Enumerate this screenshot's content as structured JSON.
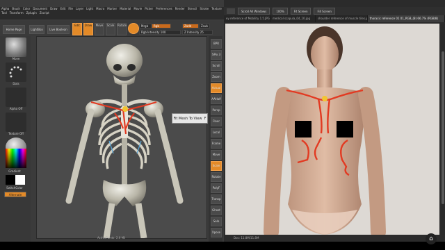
{
  "zbrush": {
    "menu": [
      "Alpha",
      "Brush",
      "Color",
      "Document",
      "Draw",
      "Edit",
      "File",
      "Layer",
      "Light",
      "Macro",
      "Marker",
      "Material",
      "Movie",
      "Picker",
      "Preferences",
      "Render",
      "Stencil",
      "Stroke",
      "Texture",
      "Tool",
      "Transform",
      "Zplugin",
      "Zscript"
    ],
    "toolbar": {
      "home_page": "Home Page",
      "lightbox": "LightBox",
      "live_boolean": "Live Boolean",
      "edit": "Edit",
      "draw": "Draw",
      "move": "Move",
      "scale": "Scale",
      "rotate": "Rotate",
      "mrgb": "Mrgb",
      "rgb": "Rgb",
      "rgb_intensity": "Rgb Intensity 100",
      "zadd": "Zadd",
      "zsub": "Zsub",
      "z_intensity": "Z Intensity 25"
    },
    "shelf": {
      "brush_label": "Move",
      "stroke_label": "Dots",
      "alpha_label": "Alpha Off",
      "texture_label": "Texture Off",
      "material_label": "Basic",
      "gradient_label": "Gradient",
      "switch_color_label": "SwitchColor",
      "alternate_label": "Alternate"
    },
    "tooltip": "Fit Mesh To View",
    "tooltip_key": "F",
    "status": "ActivePoints: 2.6 Mil",
    "right_shelf": [
      "BPR",
      "SPix 3",
      "Scroll",
      "Zoom",
      "Actual",
      "AAHalf",
      "Persp",
      "Floor",
      "Local",
      "Frame",
      "Move",
      "Scale",
      "Rotate",
      "PolyF",
      "Transp",
      "Ghost",
      "Solo",
      "Xpose"
    ]
  },
  "photoshop": {
    "options": [
      "Scroll All Windows",
      "100%",
      "Fit Screen",
      "Fill Screen"
    ],
    "tabs": [
      "ey reference of Mobility 1.5.JPG",
      "medical scapula_04_10.jpg",
      "shoulder reference of muscle tiles.jpg",
      "thoracic reference 01 01_RGB_(8) 66.7% (RGB/8)"
    ],
    "active_tab_index": 3,
    "status": "Doc: 11.8M/11.8M"
  },
  "colors": {
    "orange": "#e38a28",
    "annotation_red": "#e23a22"
  }
}
